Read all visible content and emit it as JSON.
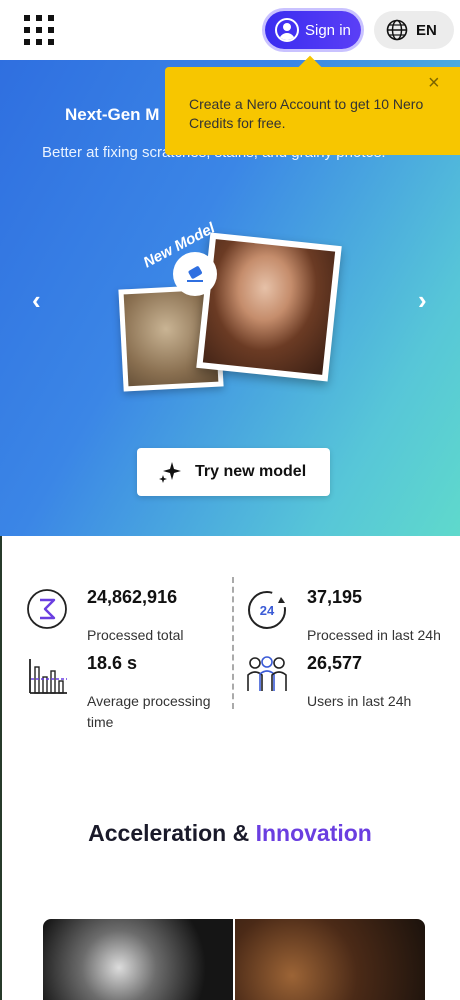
{
  "header": {
    "signin_label": "Sign in",
    "language": "EN"
  },
  "tooltip": {
    "text": "Create a Nero Account to get 10 Nero Credits for free.",
    "close": "×"
  },
  "hero": {
    "title": "Next-Gen M",
    "subtitle": "Better at fixing scratches, stains, and grainy photos.",
    "badge": "New Model",
    "cta_label": "Try new model",
    "prev": "‹",
    "next": "›"
  },
  "stats": [
    {
      "value": "24,862,916",
      "label": "Processed total",
      "icon": "sigma-icon"
    },
    {
      "value": "37,195",
      "label": "Processed in last 24h",
      "icon": "clock-24h-icon"
    },
    {
      "value": "18.6 s",
      "label": "Average processing time",
      "icon": "bar-chart-icon"
    },
    {
      "value": "26,577",
      "label": "Users in last 24h",
      "icon": "users-icon"
    }
  ],
  "section": {
    "title_main": "Acceleration & ",
    "title_accent": "Innovation"
  },
  "colors": {
    "accent": "#6a3ee0",
    "signin": "#3a2cf0",
    "tooltip": "#f7c600"
  }
}
